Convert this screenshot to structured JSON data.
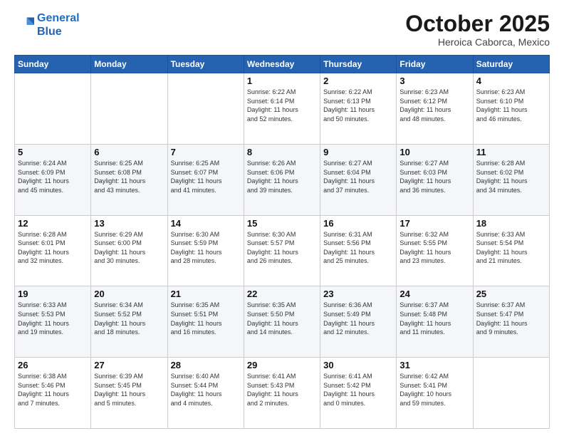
{
  "header": {
    "logo_line1": "General",
    "logo_line2": "Blue",
    "month": "October 2025",
    "location": "Heroica Caborca, Mexico"
  },
  "weekdays": [
    "Sunday",
    "Monday",
    "Tuesday",
    "Wednesday",
    "Thursday",
    "Friday",
    "Saturday"
  ],
  "weeks": [
    [
      {
        "day": "",
        "info": ""
      },
      {
        "day": "",
        "info": ""
      },
      {
        "day": "",
        "info": ""
      },
      {
        "day": "1",
        "info": "Sunrise: 6:22 AM\nSunset: 6:14 PM\nDaylight: 11 hours\nand 52 minutes."
      },
      {
        "day": "2",
        "info": "Sunrise: 6:22 AM\nSunset: 6:13 PM\nDaylight: 11 hours\nand 50 minutes."
      },
      {
        "day": "3",
        "info": "Sunrise: 6:23 AM\nSunset: 6:12 PM\nDaylight: 11 hours\nand 48 minutes."
      },
      {
        "day": "4",
        "info": "Sunrise: 6:23 AM\nSunset: 6:10 PM\nDaylight: 11 hours\nand 46 minutes."
      }
    ],
    [
      {
        "day": "5",
        "info": "Sunrise: 6:24 AM\nSunset: 6:09 PM\nDaylight: 11 hours\nand 45 minutes."
      },
      {
        "day": "6",
        "info": "Sunrise: 6:25 AM\nSunset: 6:08 PM\nDaylight: 11 hours\nand 43 minutes."
      },
      {
        "day": "7",
        "info": "Sunrise: 6:25 AM\nSunset: 6:07 PM\nDaylight: 11 hours\nand 41 minutes."
      },
      {
        "day": "8",
        "info": "Sunrise: 6:26 AM\nSunset: 6:06 PM\nDaylight: 11 hours\nand 39 minutes."
      },
      {
        "day": "9",
        "info": "Sunrise: 6:27 AM\nSunset: 6:04 PM\nDaylight: 11 hours\nand 37 minutes."
      },
      {
        "day": "10",
        "info": "Sunrise: 6:27 AM\nSunset: 6:03 PM\nDaylight: 11 hours\nand 36 minutes."
      },
      {
        "day": "11",
        "info": "Sunrise: 6:28 AM\nSunset: 6:02 PM\nDaylight: 11 hours\nand 34 minutes."
      }
    ],
    [
      {
        "day": "12",
        "info": "Sunrise: 6:28 AM\nSunset: 6:01 PM\nDaylight: 11 hours\nand 32 minutes."
      },
      {
        "day": "13",
        "info": "Sunrise: 6:29 AM\nSunset: 6:00 PM\nDaylight: 11 hours\nand 30 minutes."
      },
      {
        "day": "14",
        "info": "Sunrise: 6:30 AM\nSunset: 5:59 PM\nDaylight: 11 hours\nand 28 minutes."
      },
      {
        "day": "15",
        "info": "Sunrise: 6:30 AM\nSunset: 5:57 PM\nDaylight: 11 hours\nand 26 minutes."
      },
      {
        "day": "16",
        "info": "Sunrise: 6:31 AM\nSunset: 5:56 PM\nDaylight: 11 hours\nand 25 minutes."
      },
      {
        "day": "17",
        "info": "Sunrise: 6:32 AM\nSunset: 5:55 PM\nDaylight: 11 hours\nand 23 minutes."
      },
      {
        "day": "18",
        "info": "Sunrise: 6:33 AM\nSunset: 5:54 PM\nDaylight: 11 hours\nand 21 minutes."
      }
    ],
    [
      {
        "day": "19",
        "info": "Sunrise: 6:33 AM\nSunset: 5:53 PM\nDaylight: 11 hours\nand 19 minutes."
      },
      {
        "day": "20",
        "info": "Sunrise: 6:34 AM\nSunset: 5:52 PM\nDaylight: 11 hours\nand 18 minutes."
      },
      {
        "day": "21",
        "info": "Sunrise: 6:35 AM\nSunset: 5:51 PM\nDaylight: 11 hours\nand 16 minutes."
      },
      {
        "day": "22",
        "info": "Sunrise: 6:35 AM\nSunset: 5:50 PM\nDaylight: 11 hours\nand 14 minutes."
      },
      {
        "day": "23",
        "info": "Sunrise: 6:36 AM\nSunset: 5:49 PM\nDaylight: 11 hours\nand 12 minutes."
      },
      {
        "day": "24",
        "info": "Sunrise: 6:37 AM\nSunset: 5:48 PM\nDaylight: 11 hours\nand 11 minutes."
      },
      {
        "day": "25",
        "info": "Sunrise: 6:37 AM\nSunset: 5:47 PM\nDaylight: 11 hours\nand 9 minutes."
      }
    ],
    [
      {
        "day": "26",
        "info": "Sunrise: 6:38 AM\nSunset: 5:46 PM\nDaylight: 11 hours\nand 7 minutes."
      },
      {
        "day": "27",
        "info": "Sunrise: 6:39 AM\nSunset: 5:45 PM\nDaylight: 11 hours\nand 5 minutes."
      },
      {
        "day": "28",
        "info": "Sunrise: 6:40 AM\nSunset: 5:44 PM\nDaylight: 11 hours\nand 4 minutes."
      },
      {
        "day": "29",
        "info": "Sunrise: 6:41 AM\nSunset: 5:43 PM\nDaylight: 11 hours\nand 2 minutes."
      },
      {
        "day": "30",
        "info": "Sunrise: 6:41 AM\nSunset: 5:42 PM\nDaylight: 11 hours\nand 0 minutes."
      },
      {
        "day": "31",
        "info": "Sunrise: 6:42 AM\nSunset: 5:41 PM\nDaylight: 10 hours\nand 59 minutes."
      },
      {
        "day": "",
        "info": ""
      }
    ]
  ]
}
